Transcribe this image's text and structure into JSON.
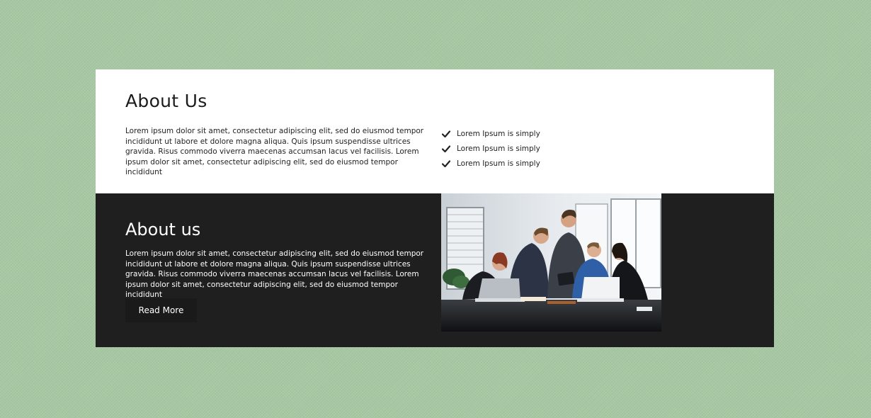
{
  "top_section": {
    "title": "About Us",
    "paragraph": "Lorem ipsum dolor sit amet, consectetur adipiscing elit, sed do eiusmod tempor incididunt ut labore et dolore magna aliqua. Quis ipsum suspendisse ultrices gravida. Risus commodo viverra maecenas accumsan lacus vel facilisis. Lorem ipsum dolor sit amet, consectetur adipiscing elit, sed do eiusmod tempor incididunt",
    "checklist": [
      {
        "label": "Lorem Ipsum is simply",
        "icon": "check-icon"
      },
      {
        "label": "Lorem Ipsum is simply",
        "icon": "check-icon"
      },
      {
        "label": "Lorem Ipsum is simply",
        "icon": "check-icon"
      }
    ]
  },
  "bottom_section": {
    "title": "About us",
    "paragraph": "Lorem ipsum dolor sit amet, consectetur adipiscing elit, sed do eiusmod tempor incididunt ut labore et dolore magna aliqua. Quis ipsum suspendisse ultrices gravida. Risus commodo viverra maecenas accumsan lacus vel facilisis. Lorem ipsum dolor sit amet, consectetur adipiscing elit, sed do eiusmod tempor incididunt",
    "button_label": "Read More",
    "image_subject": "office-team-meeting-photo"
  },
  "colors": {
    "page_background": "#a8c8a4",
    "top_background": "#ffffff",
    "bottom_background": "#1f1f1f",
    "button_background": "#1a1a1a",
    "text_dark": "#222222",
    "text_light": "#ffffff"
  }
}
